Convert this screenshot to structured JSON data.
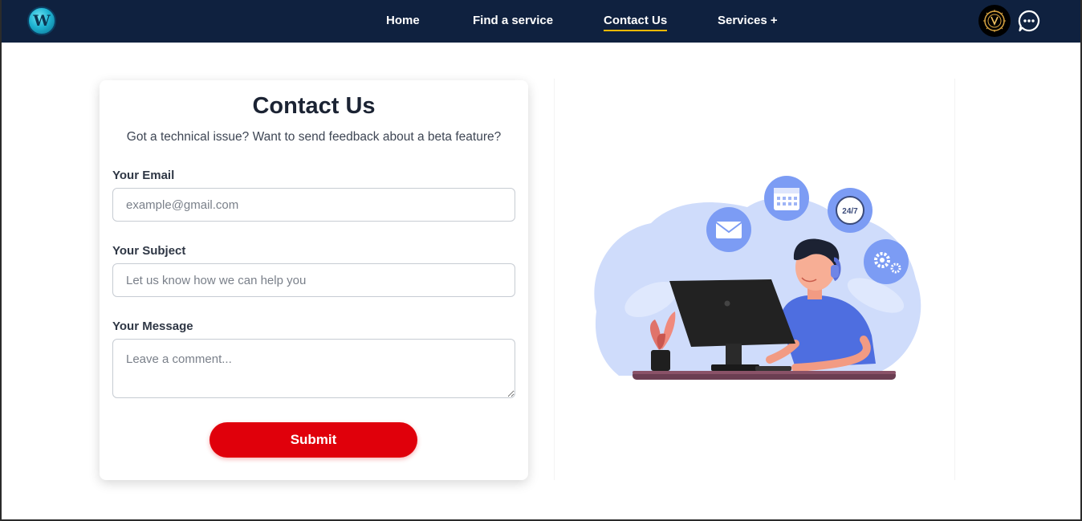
{
  "nav": {
    "logo_letter": "W",
    "links": [
      "Home",
      "Find a service",
      "Contact Us",
      "Services +"
    ],
    "active_link": "Contact Us",
    "accent_color": "#f5b800",
    "background_color": "#0f213f"
  },
  "form": {
    "title": "Contact Us",
    "subtitle": "Got a technical issue? Want to send feedback about a beta feature?",
    "email_label": "Your Email",
    "email_placeholder": "example@gmail.com",
    "subject_label": "Your Subject",
    "subject_placeholder": "Let us know how we can help you",
    "message_label": "Your Message",
    "message_placeholder": "Leave a comment...",
    "submit_label": "Submit",
    "submit_color": "#e0000b"
  },
  "illustration": {
    "badge_text": "24/7",
    "icons": [
      "mail-icon",
      "calendar-icon",
      "clock-24-7-icon",
      "gears-icon"
    ]
  }
}
